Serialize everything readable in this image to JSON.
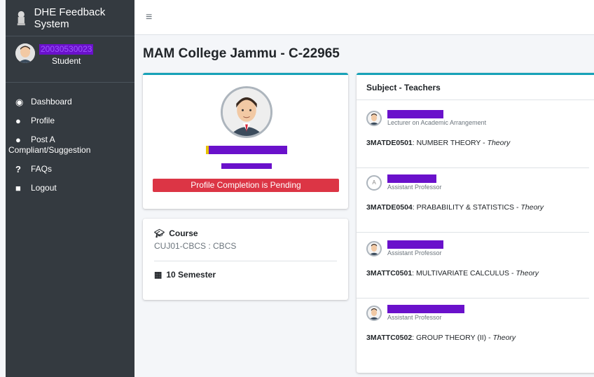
{
  "brand": {
    "title": "DHE Feedback System"
  },
  "user": {
    "id": "20030530023",
    "role": "Student"
  },
  "nav": [
    {
      "label": "Dashboard",
      "icon": "tachometer-icon"
    },
    {
      "label": "Profile",
      "icon": "user-edit-icon"
    },
    {
      "label": "Post A",
      "label2": "Compliant/Suggestion",
      "icon": "comments-icon"
    },
    {
      "label": "FAQs",
      "icon": "question-icon"
    },
    {
      "label": "Logout",
      "icon": "lock-icon"
    }
  ],
  "page": {
    "title": "MAM College Jammu - C-22965"
  },
  "profile": {
    "status_button": "Profile Completion is Pending"
  },
  "course": {
    "heading": "Course",
    "value": "CUJ01-CBCS : CBCS",
    "semester": "10 Semester"
  },
  "teachers": {
    "heading": "Subject - Teachers",
    "items": [
      {
        "title": "Lecturer on Academic Arrangement",
        "code": "3MATDE0501",
        "subject": ": NUMBER THEORY - ",
        "kind": "Theory",
        "avatar": "photo"
      },
      {
        "title": "Assistant Professor",
        "code": "3MATDE0504",
        "subject": ": PRABABILITY & STATISTICS - ",
        "kind": "Theory",
        "avatar": "broken"
      },
      {
        "title": "Assistant Professor",
        "code": "3MATTC0501",
        "subject": ": MULTIVARIATE CALCULUS - ",
        "kind": "Theory",
        "avatar": "photo"
      },
      {
        "title": "Assistant Professor",
        "code": "3MATTC0502",
        "subject": ": GROUP THEORY (II) - ",
        "kind": "Theory",
        "avatar": "photo"
      }
    ]
  },
  "colors": {
    "sidebar": "#343a40",
    "accent": "#17a2b8",
    "danger": "#dc3545",
    "redaction": "#6a11cb"
  }
}
